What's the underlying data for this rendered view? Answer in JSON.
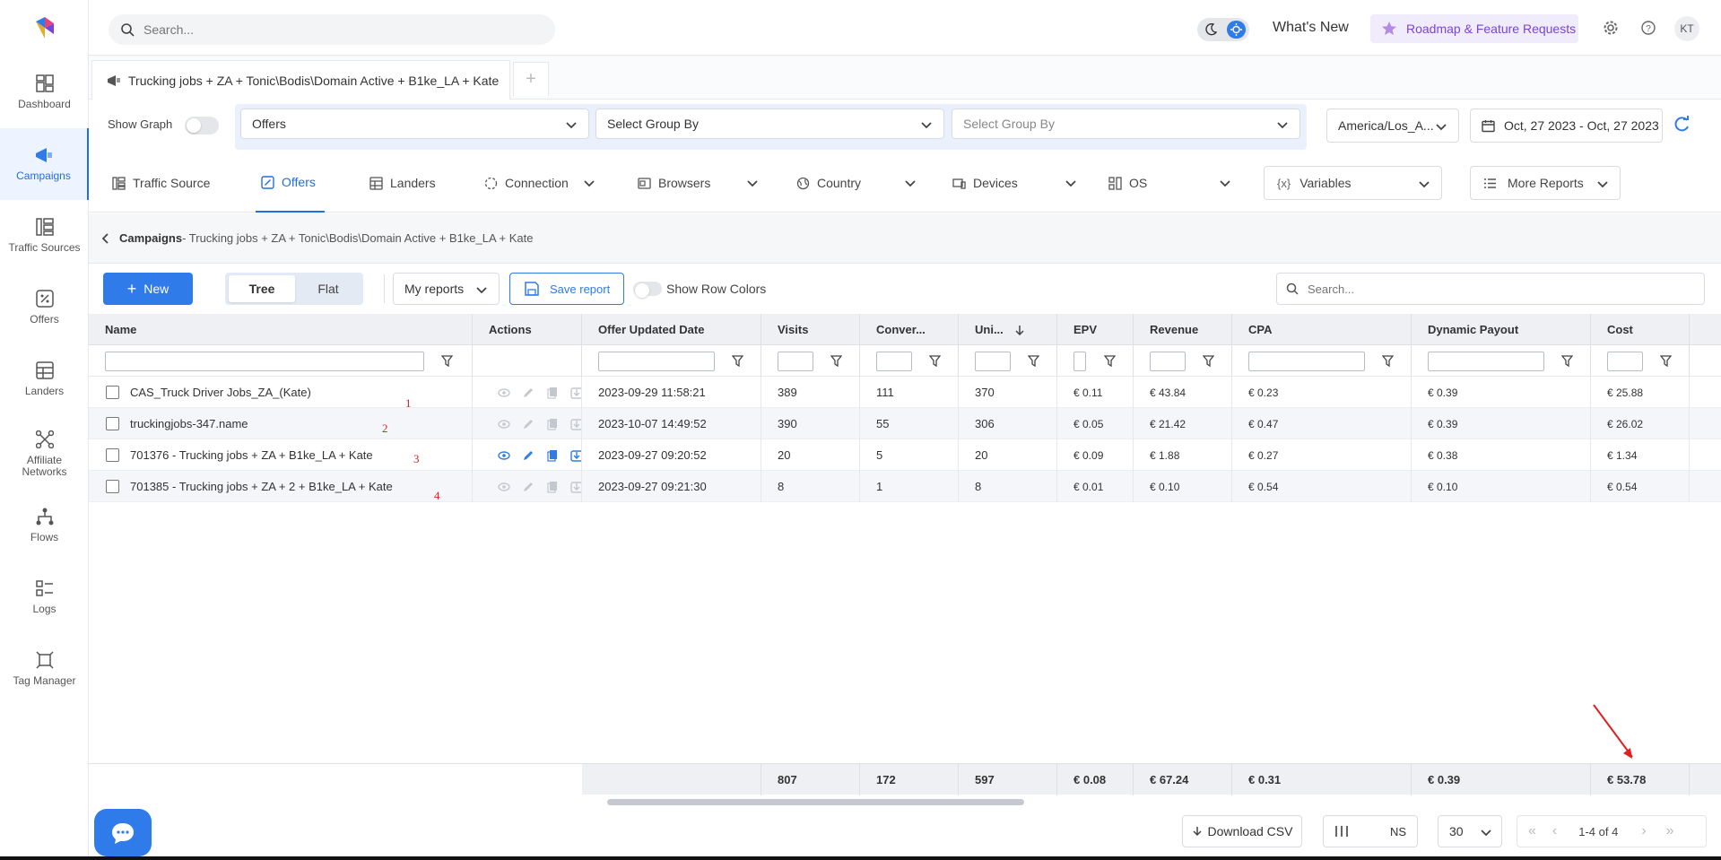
{
  "sidebar": {
    "items": [
      {
        "label": "Dashboard",
        "icon": "dashboard-icon"
      },
      {
        "label": "Campaigns",
        "icon": "megaphone-icon"
      },
      {
        "label": "Traffic Sources",
        "icon": "traffic-sources-icon"
      },
      {
        "label": "Offers",
        "icon": "offers-icon"
      },
      {
        "label": "Landers",
        "icon": "landers-icon"
      },
      {
        "label": "Affiliate Networks",
        "icon": "network-icon"
      },
      {
        "label": "Flows",
        "icon": "flows-icon"
      },
      {
        "label": "Logs",
        "icon": "logs-icon"
      },
      {
        "label": "Tag Manager",
        "icon": "tag-manager-icon"
      }
    ]
  },
  "topbar": {
    "search_placeholder": "Search...",
    "whats_new": "What's New",
    "roadmap": "Roadmap & Feature Requests",
    "avatar": "KT"
  },
  "tabs": {
    "active": "Trucking jobs + ZA + Tonic\\Bodis\\Domain Active + B1ke_LA + Kate",
    "add": "+"
  },
  "filters": {
    "show_graph": "Show Graph",
    "group1": "Offers",
    "group2": "Select Group By",
    "group3": "Select Group By",
    "timezone": "America/Los_A...",
    "daterange": "Oct, 27 2023 - Oct, 27 2023"
  },
  "report_tabs": {
    "traffic_source": "Traffic Source",
    "offers": "Offers",
    "landers": "Landers",
    "connection": "Connection",
    "browsers": "Browsers",
    "country": "Country",
    "devices": "Devices",
    "os": "OS",
    "variables": "Variables",
    "more_reports": "More Reports"
  },
  "breadcrumb": {
    "root": "Campaigns",
    "path": " - Trucking jobs + ZA + Tonic\\Bodis\\Domain Active + B1ke_LA + Kate"
  },
  "toolbar": {
    "new": "New",
    "tree": "Tree",
    "flat": "Flat",
    "my_reports": "My reports",
    "save_report": "Save report",
    "show_row_colors": "Show Row Colors",
    "search_placeholder": "Search..."
  },
  "table": {
    "columns": [
      "Name",
      "Actions",
      "Offer Updated Date",
      "Visits",
      "Conver...",
      "Uni...",
      "EPV",
      "Revenue",
      "CPA",
      "Dynamic Payout",
      "Cost"
    ],
    "rows": [
      {
        "name": "CAS_Truck Driver Jobs_ZA_(Kate)",
        "date": "2023-09-29 11:58:21",
        "visits": "389",
        "conv": "111",
        "uni": "370",
        "epv": "€ 0.11",
        "revenue": "€ 43.84",
        "cpa": "€ 0.23",
        "payout": "€ 0.39",
        "cost": "€ 25.88",
        "anno": "1"
      },
      {
        "name": "truckingjobs-347.name",
        "date": "2023-10-07 14:49:52",
        "visits": "390",
        "conv": "55",
        "uni": "306",
        "epv": "€ 0.05",
        "revenue": "€ 21.42",
        "cpa": "€ 0.47",
        "payout": "€ 0.39",
        "cost": "€ 26.02",
        "anno": "2"
      },
      {
        "name": "701376 - Trucking jobs + ZA + B1ke_LA + Kate",
        "date": "2023-09-27 09:20:52",
        "visits": "20",
        "conv": "5",
        "uni": "20",
        "epv": "€ 0.09",
        "revenue": "€ 1.88",
        "cpa": "€ 0.27",
        "payout": "€ 0.38",
        "cost": "€ 1.34",
        "anno": "3"
      },
      {
        "name": "701385 - Trucking jobs + ZA + 2 + B1ke_LA + Kate",
        "date": "2023-09-27 09:21:30",
        "visits": "8",
        "conv": "1",
        "uni": "8",
        "epv": "€ 0.01",
        "revenue": "€ 0.10",
        "cpa": "€ 0.54",
        "payout": "€ 0.10",
        "cost": "€ 0.54",
        "anno": "4"
      }
    ],
    "totals": {
      "visits": "807",
      "conv": "172",
      "uni": "597",
      "epv": "€ 0.08",
      "revenue": "€ 67.24",
      "cpa": "€ 0.31",
      "payout": "€ 0.39",
      "cost": "€ 53.78"
    }
  },
  "footer": {
    "download": "Download CSV",
    "columns_label": "NS",
    "page_size": "30",
    "range": "1-4 of 4"
  },
  "colors": {
    "accent": "#2f7be9",
    "annotation": "#e02020",
    "roadmap": "#7a43d9"
  }
}
